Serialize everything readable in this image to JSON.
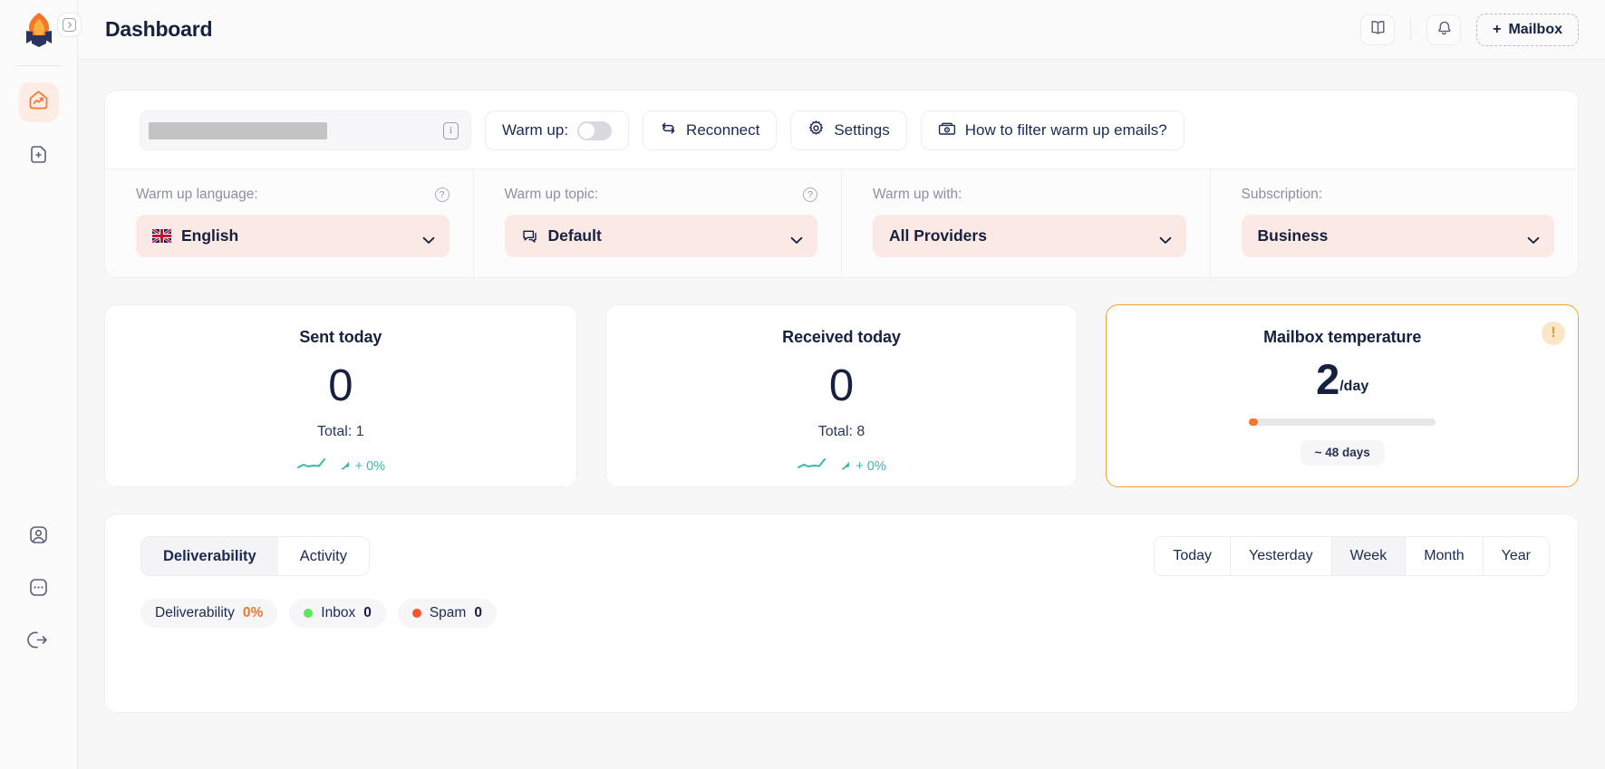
{
  "app": {
    "brand_icon": "flame-logo-icon",
    "accent_color": "#f4762a",
    "warn_color": "#f0a33c",
    "teal_color": "#3cb8a5",
    "pink_bg": "#fae9e4"
  },
  "sidebar": {
    "collapse_icon": "chevron-right-icon",
    "items": [
      {
        "icon": "dashboard-home-trend-icon",
        "name": "sidebar-item-dashboard",
        "active": true
      },
      {
        "icon": "add-document-icon",
        "name": "sidebar-item-new-document",
        "active": false
      }
    ],
    "bottom_items": [
      {
        "icon": "user-profile-icon",
        "name": "sidebar-item-profile"
      },
      {
        "icon": "more-dots-icon",
        "name": "sidebar-item-more"
      },
      {
        "icon": "logout-icon",
        "name": "sidebar-item-logout"
      }
    ]
  },
  "header": {
    "title": "Dashboard",
    "book_icon": "book-icon",
    "bell_icon": "bell-icon",
    "mailbox_plus": "+",
    "mailbox_label": "Mailbox"
  },
  "warmup_panel": {
    "email_value": "",
    "email_redacted": true,
    "info_icon_label": "i",
    "warm_up_label": "Warm up:",
    "warm_up_enabled": false,
    "reconnect_label": "Reconnect",
    "reconnect_icon": "refresh-icon",
    "settings_label": "Settings",
    "settings_icon": "gear-icon",
    "filter_help_label": "How to filter warm up emails?",
    "filter_help_icon": "folder-eye-icon",
    "filters": [
      {
        "label": "Warm up language:",
        "value": "English",
        "icon": "uk-flag-icon",
        "has_help": true,
        "name": "warm-up-language"
      },
      {
        "label": "Warm up topic:",
        "value": "Default",
        "icon": "chat-bubble-icon",
        "has_help": true,
        "name": "warm-up-topic"
      },
      {
        "label": "Warm up with:",
        "value": "All Providers",
        "icon": "",
        "has_help": false,
        "name": "warm-up-with"
      },
      {
        "label": "Subscription:",
        "value": "Business",
        "icon": "",
        "has_help": false,
        "name": "subscription"
      }
    ]
  },
  "stats": {
    "sent": {
      "title": "Sent today",
      "value": "0",
      "total": "Total: 1",
      "trend": "+ 0%",
      "trend_icon": "trend-up-arrow-icon"
    },
    "received": {
      "title": "Received today",
      "value": "0",
      "total": "Total: 8",
      "trend": "+ 0%",
      "trend_icon": "trend-up-arrow-icon"
    },
    "temperature": {
      "title": "Mailbox temperature",
      "value": "2",
      "unit": "/day",
      "progress_percent": 5,
      "days_label": "~ 48 days",
      "warn_icon": "warning-exclamation-icon"
    }
  },
  "analytics": {
    "tabs": [
      {
        "label": "Deliverability",
        "active": true
      },
      {
        "label": "Activity",
        "active": false
      }
    ],
    "ranges": [
      {
        "label": "Today",
        "active": false
      },
      {
        "label": "Yesterday",
        "active": false
      },
      {
        "label": "Week",
        "active": true
      },
      {
        "label": "Month",
        "active": false
      },
      {
        "label": "Year",
        "active": false
      }
    ],
    "chips": [
      {
        "label": "Deliverability",
        "value": "0%",
        "dot": null,
        "accent": true,
        "name": "chip-deliverability"
      },
      {
        "label": "Inbox",
        "value": "0",
        "dot": "#5ce65c",
        "accent": false,
        "name": "chip-inbox"
      },
      {
        "label": "Spam",
        "value": "0",
        "dot": "#f4562a",
        "accent": false,
        "name": "chip-spam"
      }
    ]
  }
}
